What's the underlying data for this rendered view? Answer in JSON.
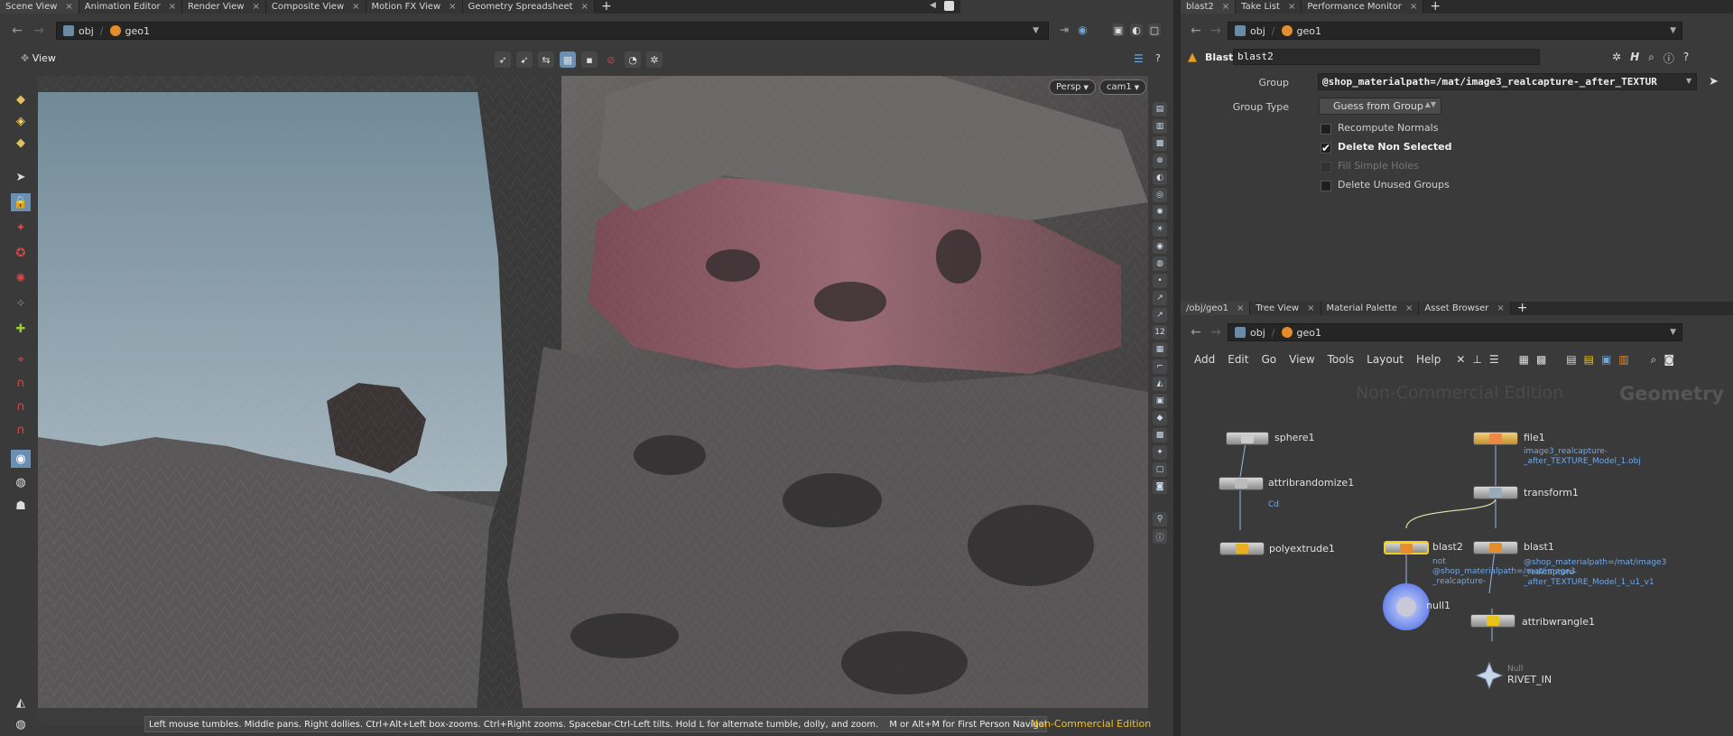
{
  "left_tabs": [
    "Scene View",
    "Animation Editor",
    "Render View",
    "Composite View",
    "Motion FX View",
    "Geometry Spreadsheet"
  ],
  "left_path": {
    "crumbs": [
      "obj",
      "geo1"
    ]
  },
  "viewer": {
    "label": "View",
    "persp": "Persp",
    "camera": "cam1",
    "status": "Left mouse tumbles. Middle pans. Right dollies. Ctrl+Alt+Left box-zooms. Ctrl+Right zooms. Spacebar-Ctrl-Left tilts. Hold L for alternate tumble, dolly, and zoom.",
    "status2": "M or Alt+M for First Person Navigation.",
    "edition": "Non-Commercial Edition"
  },
  "param_tabs": [
    "blast2",
    "Take List",
    "Performance Monitor"
  ],
  "param_path": {
    "crumbs": [
      "obj",
      "geo1"
    ]
  },
  "params": {
    "node_type": "Blast",
    "node_name": "blast2",
    "group_label": "Group",
    "group_value": "@shop_materialpath=/mat/image3_realcapture-_after_TEXTUR",
    "group_type_label": "Group Type",
    "group_type_value": "Guess from Group",
    "toggles": [
      {
        "label": "Recompute Normals",
        "checked": false,
        "enabled": true
      },
      {
        "label": "Delete Non Selected",
        "checked": true,
        "enabled": true
      },
      {
        "label": "Fill Simple Holes",
        "checked": false,
        "enabled": false
      },
      {
        "label": "Delete Unused Groups",
        "checked": false,
        "enabled": true
      }
    ]
  },
  "net_tabs": [
    "/obj/geo1",
    "Tree View",
    "Material Palette",
    "Asset Browser"
  ],
  "net_path": {
    "crumbs": [
      "obj",
      "geo1"
    ]
  },
  "net_menu": [
    "Add",
    "Edit",
    "Go",
    "View",
    "Tools",
    "Layout",
    "Help"
  ],
  "network": {
    "watermark": "Non-Commercial Edition",
    "context": "Geometry",
    "nodes": [
      {
        "name": "sphere1"
      },
      {
        "name": "attribrandomize1",
        "sub": "Cd"
      },
      {
        "name": "polyextrude1"
      },
      {
        "name": "file1",
        "sub": "image3_realcapture-\n_after_TEXTURE_Model_1.obj"
      },
      {
        "name": "transform1"
      },
      {
        "name": "blast2",
        "sub": "not\n@shop_materialpath=/mat/image3\n_realcapture-"
      },
      {
        "name": "blast1",
        "sub": "@shop_materialpath=/mat/image3\n_realcapture-\n_after_TEXTURE_Model_1_u1_v1"
      },
      {
        "name": "null1"
      },
      {
        "name": "attribwrangle1"
      },
      {
        "name": "RIVET_IN",
        "sub": "Null"
      }
    ]
  },
  "colors": {
    "accent": "#e8c21b",
    "link": "#6fa8e8",
    "sky": "#7f97a5"
  }
}
